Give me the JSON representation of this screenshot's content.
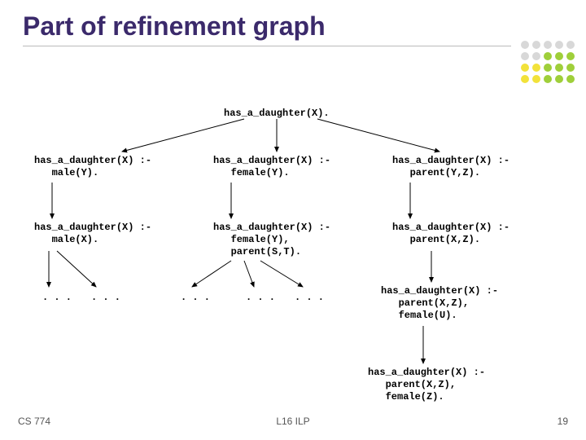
{
  "title": "Part of refinement graph",
  "root": "has_a_daughter(X).",
  "row1": {
    "c0": "has_a_daughter(X) :-\n   male(Y).",
    "c1": "has_a_daughter(X) :-\n   female(Y).",
    "c2": "has_a_daughter(X) :-\n   parent(Y,Z)."
  },
  "row2": {
    "c0": "has_a_daughter(X) :-\n   male(X).",
    "c1": "has_a_daughter(X) :-\n   female(Y),\n   parent(S,T).",
    "c2": "has_a_daughter(X) :-\n   parent(X,Z)."
  },
  "row3": {
    "c2a": "has_a_daughter(X) :-\n   parent(X,Z),\n   female(U).",
    "c2b": "has_a_daughter(X) :-\n   parent(X,Z),\n   female(Z)."
  },
  "ellipsis": ". . .",
  "footer": {
    "left": "CS 774",
    "center": "L16 ILP",
    "right": "19"
  },
  "dotColors": [
    "#d8d8d8",
    "#d8d8d8",
    "#d8d8d8",
    "#d8d8d8",
    "#d8d8d8",
    "#d8d8d8",
    "#d8d8d8",
    "#9fcf3a",
    "#9fcf3a",
    "#9fcf3a",
    "#f2e23a",
    "#f2e23a",
    "#9fcf3a",
    "#9fcf3a",
    "#9fcf3a",
    "#f2e23a",
    "#f2e23a",
    "#9fcf3a",
    "#9fcf3a",
    "#9fcf3a"
  ]
}
